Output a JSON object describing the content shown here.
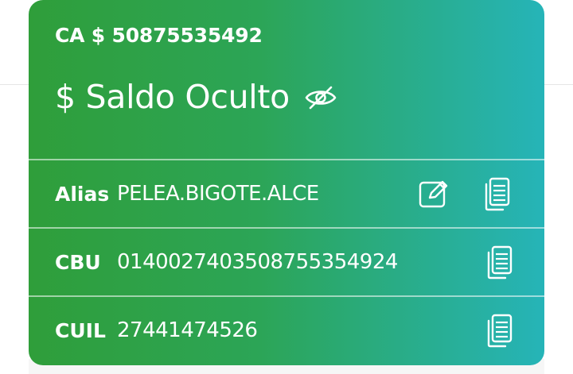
{
  "account": {
    "label": "CA $ 50875535492"
  },
  "balance": {
    "text": "$ Saldo Oculto",
    "toggle_icon": "eye-slash-icon"
  },
  "rows": [
    {
      "label": "Alias",
      "value": "PELEA.BIGOTE.ALCE",
      "icons": [
        "edit-icon",
        "copy-icon"
      ]
    },
    {
      "label": "CBU",
      "value": "0140027403508755354924",
      "icons": [
        "copy-icon"
      ]
    },
    {
      "label": "CUIL",
      "value": "27441474526",
      "icons": [
        "copy-icon"
      ]
    }
  ],
  "colors": {
    "gradient_start": "#2f9e3a",
    "gradient_end": "#26b4b8",
    "text": "#ffffff"
  }
}
